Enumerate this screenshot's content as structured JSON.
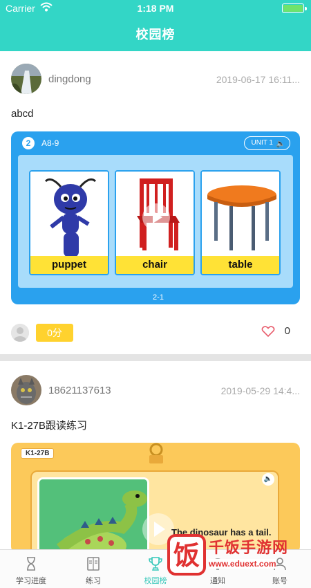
{
  "status_bar": {
    "carrier": "Carrier",
    "time": "1:18 PM"
  },
  "nav": {
    "title": "校园榜"
  },
  "posts": [
    {
      "username": "dingdong",
      "date": "2019-06-17 16:11...",
      "text": "abcd",
      "card": {
        "lesson_number": "2",
        "lesson_code": "A8-9",
        "unit": "UNIT 1",
        "items": [
          "puppet",
          "chair",
          "table"
        ],
        "page": "2-1"
      },
      "score": "0分",
      "likes": "0"
    },
    {
      "username": "18621137613",
      "date": "2019-05-29 14:4...",
      "text": "K1-27B跟读练习",
      "card": {
        "code": "K1-27B",
        "sentence": "The dinosaur has a tail."
      }
    }
  ],
  "tabs": [
    {
      "label": "学习进度",
      "icon": "hourglass-icon"
    },
    {
      "label": "练习",
      "icon": "book-icon"
    },
    {
      "label": "校园榜",
      "icon": "trophy-icon"
    },
    {
      "label": "通知",
      "icon": "bell-icon"
    },
    {
      "label": "账号",
      "icon": "person-icon"
    }
  ],
  "watermark": {
    "name": "千饭手游网",
    "url": "www.eduext.com",
    "logo_char": "饭"
  },
  "colors": {
    "accent": "#33d6c6",
    "blue_card": "#2aa1ee",
    "yellow_card": "#fcc95a",
    "score_badge": "#ffd22e",
    "watermark": "#e03232"
  }
}
